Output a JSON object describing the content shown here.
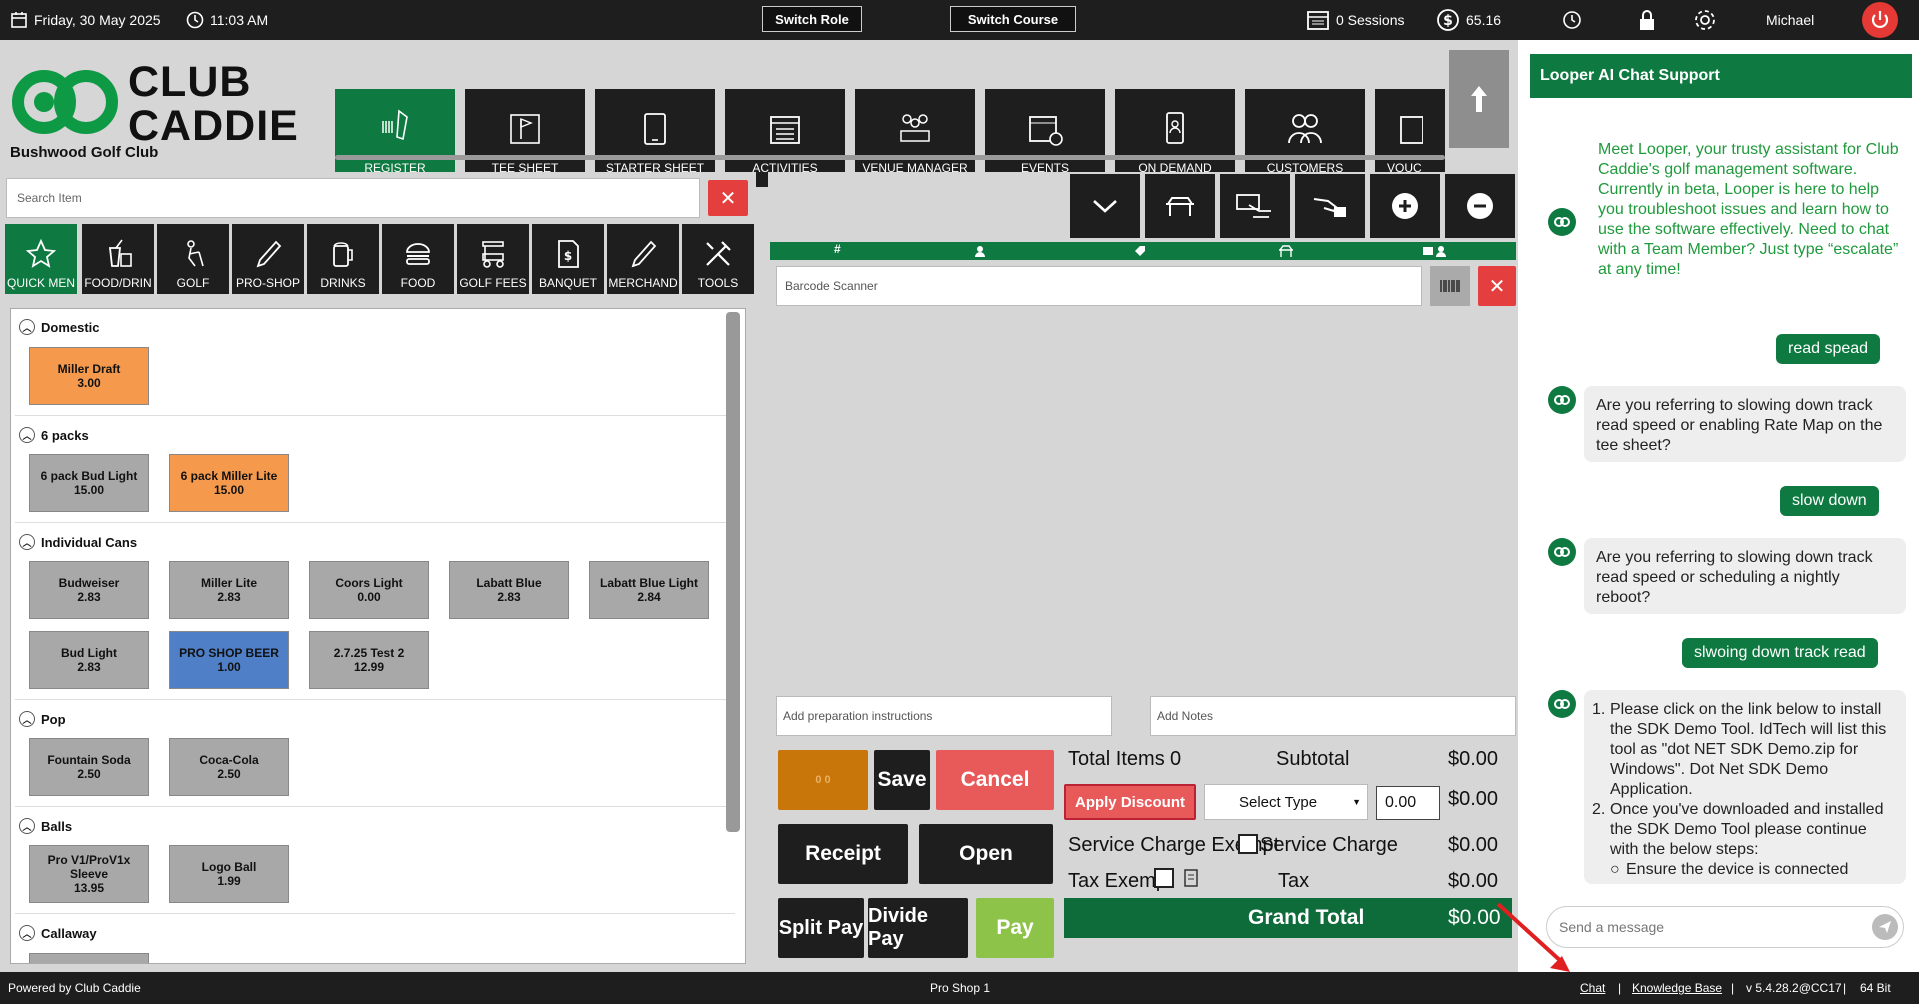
{
  "topbar": {
    "date": "Friday,  30 May 2025",
    "time": "11:03 AM",
    "switch_role": "Switch Role",
    "switch_course": "Switch Course",
    "sessions": "0 Sessions",
    "balance": "65.16",
    "user": "Michael"
  },
  "logo": {
    "line1": "CLUB",
    "line2": "CADDIE",
    "club": "Bushwood Golf Club"
  },
  "nav": [
    "REGISTER",
    "TEE SHEET",
    "STARTER SHEET",
    "ACTIVITIES",
    "VENUE MANAGER",
    "EVENTS",
    "ON DEMAND",
    "CUSTOMERS",
    "VOUC"
  ],
  "search": {
    "placeholder": "Search Item"
  },
  "categories": [
    "QUICK MEN",
    "FOOD/DRIN",
    "GOLF",
    "PRO-SHOP",
    "DRINKS",
    "FOOD",
    "GOLF FEES",
    "BANQUET",
    "MERCHAND",
    "TOOLS"
  ],
  "sections": [
    {
      "name": "Domestic",
      "items": [
        {
          "name": "Miller Draft",
          "price": "3.00",
          "color": "orange"
        }
      ]
    },
    {
      "name": "6 packs",
      "items": [
        {
          "name": "6 pack Bud Light",
          "price": "15.00",
          "color": "gray"
        },
        {
          "name": "6 pack Miller Lite",
          "price": "15.00",
          "color": "orange"
        }
      ]
    },
    {
      "name": "Individual Cans",
      "items": [
        {
          "name": "Budweiser",
          "price": "2.83",
          "color": "gray"
        },
        {
          "name": "Miller Lite",
          "price": "2.83",
          "color": "gray"
        },
        {
          "name": "Coors Light",
          "price": "0.00",
          "color": "gray"
        },
        {
          "name": "Labatt Blue",
          "price": "2.83",
          "color": "gray"
        },
        {
          "name": "Labatt Blue Light",
          "price": "2.84",
          "color": "gray"
        },
        {
          "name": "Bud Light",
          "price": "2.83",
          "color": "gray"
        },
        {
          "name": "PRO SHOP BEER",
          "price": "1.00",
          "color": "blue"
        },
        {
          "name": "2.7.25 Test 2",
          "price": "12.99",
          "color": "gray"
        }
      ]
    },
    {
      "name": "Pop",
      "items": [
        {
          "name": "Fountain Soda",
          "price": "2.50",
          "color": "gray"
        },
        {
          "name": "Coca-Cola",
          "price": "2.50",
          "color": "gray"
        }
      ]
    },
    {
      "name": "Balls",
      "items": [
        {
          "name": "Pro V1/ProV1x Sleeve",
          "price": "13.95",
          "color": "gray"
        },
        {
          "name": "Logo Ball",
          "price": "1.99",
          "color": "gray"
        }
      ]
    },
    {
      "name": "Callaway",
      "items": []
    }
  ],
  "register": {
    "barcode_placeholder": "Barcode Scanner",
    "prep_placeholder": "Add preparation instructions",
    "notes_placeholder": "Add Notes",
    "tab_counts": "0  0",
    "save": "Save",
    "cancel": "Cancel",
    "receipt": "Receipt",
    "open": "Open",
    "split_pay": "Split Pay",
    "divide_pay": "Divide Pay",
    "pay": "Pay"
  },
  "totals": {
    "total_items_label": "Total Items",
    "total_items": "0",
    "subtotal_label": "Subtotal",
    "subtotal": "$0.00",
    "apply_discount": "Apply Discount",
    "select_type": "Select Type",
    "discount_value": "0.00",
    "discount_amount": "$0.00",
    "service_exempt": "Service Charge Exempt",
    "service_charge_label": "Service Charge",
    "service_charge": "$0.00",
    "tax_exempt": "Tax Exempt",
    "tax_label": "Tax",
    "tax": "$0.00",
    "grand_total_label": "Grand Total",
    "grand_total": "$0.00"
  },
  "chat": {
    "title": "Looper AI Chat Support",
    "intro": "Meet Looper, your trusty assistant for Club Caddie's golf management software. Currently in beta, Looper is here to help you troubleshoot issues and learn how to use the software effectively. Need to chat with a Team Member? Just type “escalate” at any time!",
    "u1": "read spead",
    "b1": "Are you referring to slowing down track read speed or enabling Rate Map on the tee sheet?",
    "u2": "slow down",
    "b2": "Are you referring to slowing down track read speed or scheduling a nightly reboot?",
    "u3": "slwoing down track read",
    "b3_1": "Please click on the link below to install the SDK Demo Tool. IdTech will list this tool as \"dot NET SDK Demo.zip for Windows\". Dot Net SDK Demo Application.",
    "b3_2": "Once you've downloaded and installed the SDK Demo Tool please continue with the below steps:",
    "b3_3": "Ensure the device is connected",
    "send_placeholder": "Send a message"
  },
  "footer": {
    "powered": "Powered by Club Caddie",
    "location": "Pro Shop 1",
    "chat": "Chat",
    "kb": "Knowledge Base",
    "version": "v 5.4.28.2@CC17",
    "bits": "64 Bit",
    "sep": "|"
  },
  "colors": {
    "green": "#0e7a41",
    "red": "#e53e3e",
    "orange": "#f59a4d",
    "blue": "#4f7fc6",
    "dark": "#1e1e1e"
  }
}
